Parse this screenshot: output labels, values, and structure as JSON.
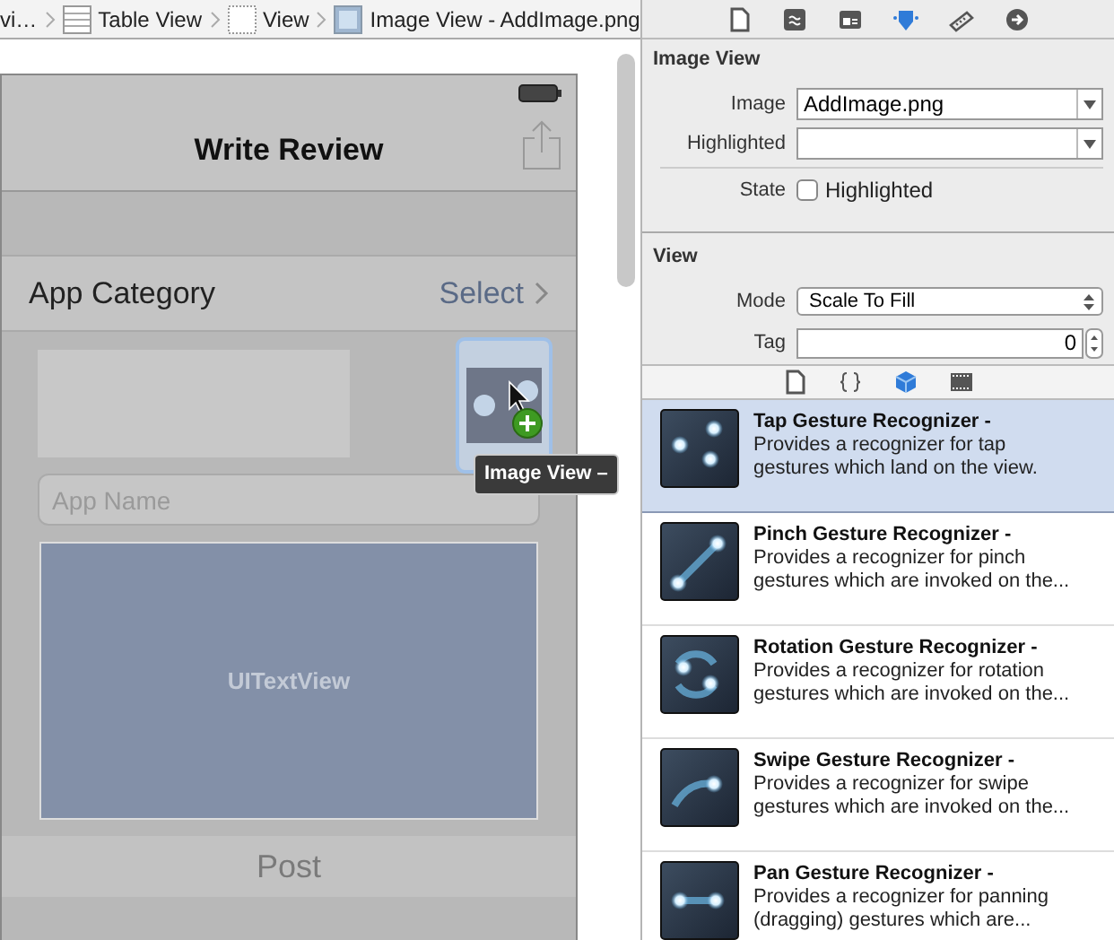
{
  "breadcrumb": [
    {
      "kind": "none",
      "label": "vi…"
    },
    {
      "kind": "table",
      "label": "Table View"
    },
    {
      "kind": "view",
      "label": "View"
    },
    {
      "kind": "image",
      "label": "Image View - AddImage.png"
    }
  ],
  "canvas": {
    "nav_title": "Write Review",
    "category_label": "App Category",
    "category_value": "Select",
    "app_name_placeholder": "App Name",
    "text_view_label": "UITextView",
    "post_button": "Post",
    "drag_tooltip": "Image View –"
  },
  "inspector_tabs": [
    {
      "kind": "file",
      "selected": false
    },
    {
      "kind": "help",
      "selected": false
    },
    {
      "kind": "identity",
      "selected": false
    },
    {
      "kind": "attributes",
      "selected": true
    },
    {
      "kind": "ruler",
      "selected": false
    },
    {
      "kind": "connections",
      "selected": false
    }
  ],
  "image_view": {
    "title": "Image View",
    "image_label": "Image",
    "image_value": "AddImage.png",
    "highlighted_label": "Highlighted",
    "state_label": "State",
    "state_checkbox": {
      "label": "Highlighted",
      "checked": false
    }
  },
  "view": {
    "title": "View",
    "mode_label": "Mode",
    "mode_value": "Scale To Fill",
    "tag_label": "Tag",
    "tag_value": "0"
  },
  "library_tabs": [
    {
      "kind": "file",
      "selected": false
    },
    {
      "kind": "code",
      "selected": false
    },
    {
      "kind": "object",
      "selected": true
    },
    {
      "kind": "media",
      "selected": false
    }
  ],
  "library": [
    {
      "kind": "tap",
      "title": "Tap Gesture Recognizer -",
      "description": "Provides a recognizer for tap gestures which land on the view.",
      "selected": true
    },
    {
      "kind": "pinch",
      "title": "Pinch Gesture Recognizer -",
      "description": "Provides a recognizer for pinch gestures which are invoked on the...",
      "selected": false
    },
    {
      "kind": "rotation",
      "title": "Rotation Gesture Recognizer -",
      "description": "Provides a recognizer for rotation gestures which are invoked on the...",
      "selected": false
    },
    {
      "kind": "swipe",
      "title": "Swipe Gesture Recognizer -",
      "description": "Provides a recognizer for swipe gestures which are invoked on the...",
      "selected": false
    },
    {
      "kind": "pan",
      "title": "Pan Gesture Recognizer -",
      "description": "Provides a recognizer for panning (dragging) gestures which are...",
      "selected": false
    }
  ]
}
